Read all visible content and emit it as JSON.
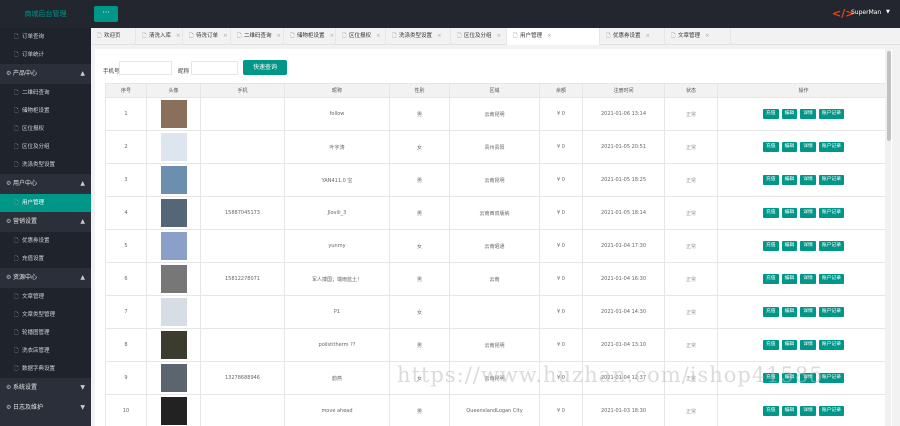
{
  "brand": "商城后台管理",
  "colors": {
    "accent": "#009688",
    "sidebar": "#2b2f3a",
    "topbar": "#23262e"
  },
  "topbar": {
    "menu_icon": "···",
    "logo_icon": "</>",
    "user": "SuperMan"
  },
  "sidebar": {
    "pre_items": [
      "订单查询",
      "订单统计"
    ],
    "groups": [
      {
        "label": "产品中心",
        "items": [
          "二维码查询",
          "储物柜设置",
          "区位报权",
          "区位及分组",
          "洗涤类型设置"
        ]
      },
      {
        "label": "用户中心",
        "items": [
          "用户管理"
        ]
      },
      {
        "label": "营销设置",
        "items": [
          "优惠券设置",
          "充值设置"
        ]
      },
      {
        "label": "资源中心",
        "items": [
          "文章管理",
          "文章类型管理",
          "轮播图管理",
          "洗衣店管理",
          "数据字典设置"
        ]
      },
      {
        "label": "系统设置",
        "items": []
      },
      {
        "label": "日志及维护",
        "items": []
      }
    ]
  },
  "tabs": [
    "欢迎页",
    "清洗入库",
    "待洗订单",
    "二维码查询",
    "储物柜设置",
    "区位报权",
    "洗涤类型设置",
    "区位及分组",
    "用户管理",
    "优惠券设置",
    "文章管理"
  ],
  "filters": {
    "phone_label": "手机号",
    "nickname_label": "昵称",
    "search_button": "快速查询"
  },
  "table": {
    "headers": [
      "序号",
      "头像",
      "手机",
      "昵称",
      "性别",
      "区域",
      "余额",
      "注册时间",
      "状态",
      "操作"
    ],
    "actions": [
      "充值",
      "编辑",
      "详情",
      "账户记录"
    ],
    "rows": [
      {
        "no": "1",
        "phone": "",
        "nick": "follow",
        "gender": "男",
        "region": "云南昆明",
        "balance": "¥ 0",
        "time": "2021-01-06 13:14",
        "status": "正常"
      },
      {
        "no": "2",
        "phone": "",
        "nick": "叶宇涛",
        "gender": "女",
        "region": "贵州贵阳",
        "balance": "¥ 0",
        "time": "2021-01-05 20:51",
        "status": "正常"
      },
      {
        "no": "3",
        "phone": "",
        "nick": "YAN411.0 宝",
        "gender": "男",
        "region": "云南昆明",
        "balance": "¥ 0",
        "time": "2021-01-05 18:25",
        "status": "正常"
      },
      {
        "no": "4",
        "phone": "15887045173",
        "nick": "Jlovili_3",
        "gender": "男",
        "region": "云南西双版纳",
        "balance": "¥ 0",
        "time": "2021-01-05 18:14",
        "status": "正常"
      },
      {
        "no": "5",
        "phone": "",
        "nick": "yunmy",
        "gender": "女",
        "region": "云南昭通",
        "balance": "¥ 0",
        "time": "2021-01-04 17:30",
        "status": "正常"
      },
      {
        "no": "6",
        "phone": "15812278071",
        "nick": "军人搏国；端雨蓝土！",
        "gender": "男",
        "region": "云南",
        "balance": "¥ 0",
        "time": "2021-01-04 16:30",
        "status": "正常"
      },
      {
        "no": "7",
        "phone": "",
        "nick": "P1",
        "gender": "女",
        "region": "",
        "balance": "¥ 0",
        "time": "2021-01-04 14:30",
        "status": "正常"
      },
      {
        "no": "8",
        "phone": "",
        "nick": "poilstitherm ??",
        "gender": "男",
        "region": "云南昆明",
        "balance": "¥ 0",
        "time": "2021-01-04 13:10",
        "status": "正常"
      },
      {
        "no": "9",
        "phone": "13278688946",
        "nick": "韵燕",
        "gender": "女",
        "region": "云南昆明",
        "balance": "¥ 0",
        "time": "2021-01-04 12:37",
        "status": "正常"
      },
      {
        "no": "10",
        "phone": "",
        "nick": "move ahead",
        "gender": "男",
        "region": "QueenslandLogan City",
        "balance": "¥ 0",
        "time": "2021-01-03 18:30",
        "status": "正常"
      }
    ]
  },
  "watermark": "https://www.huzhan.com/ishop41585"
}
